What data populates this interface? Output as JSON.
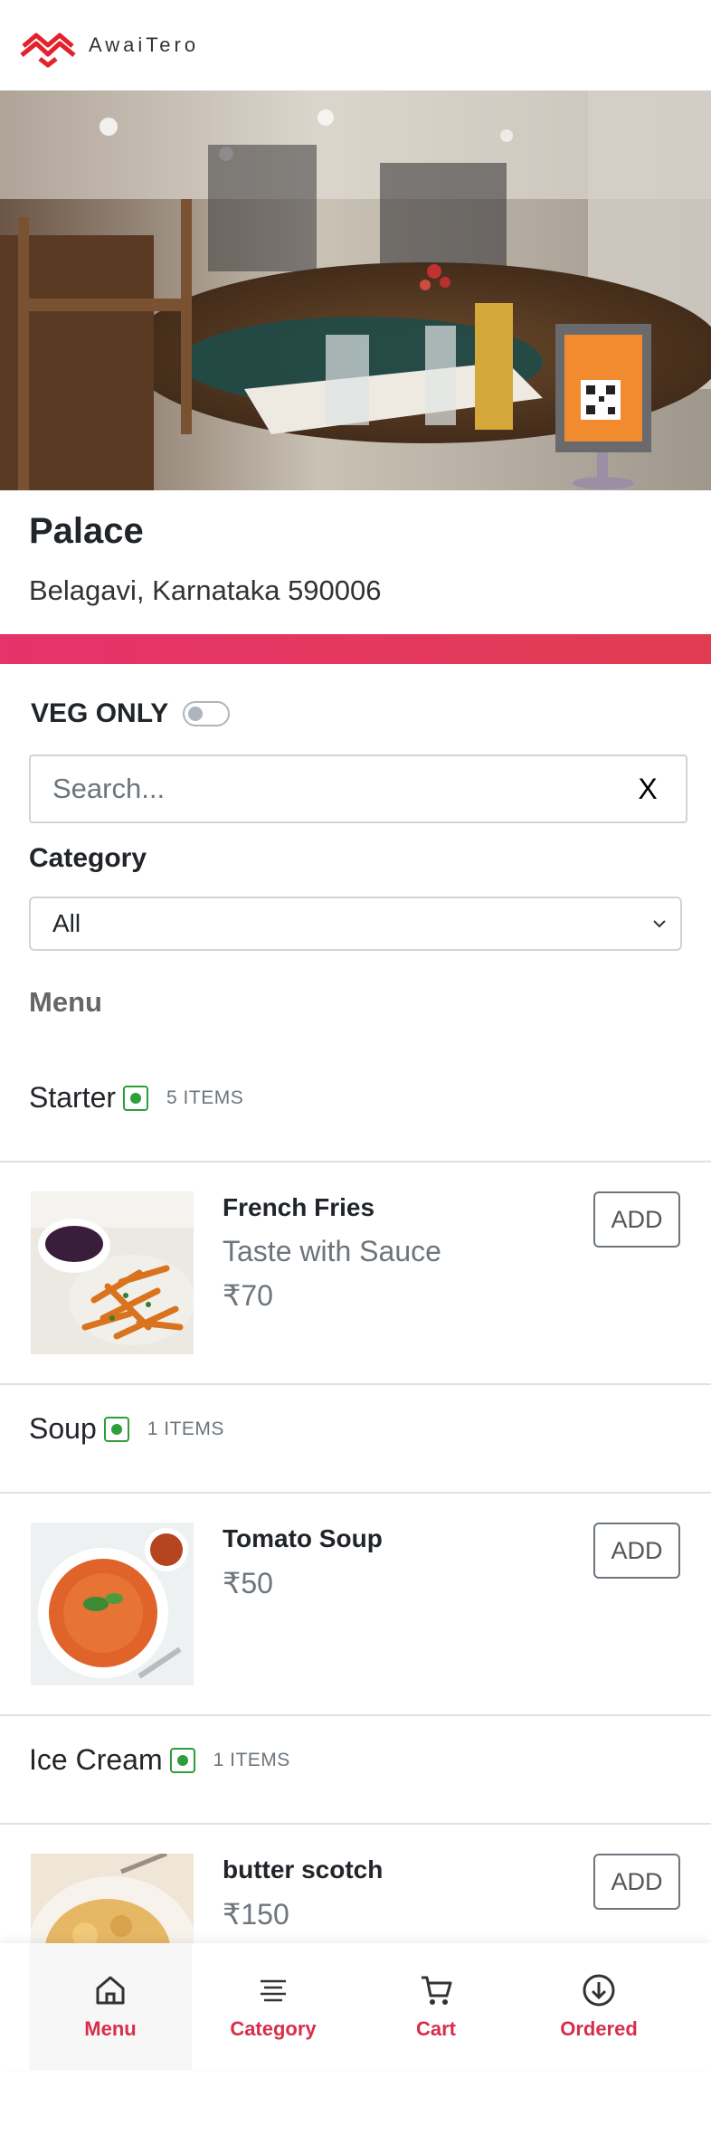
{
  "header": {
    "brand": "AwaiTero",
    "logo_icon": "awaitero-logo-icon"
  },
  "hero": {
    "image": "restaurant-table-photo",
    "qr_stand_icon": "qr-stand-icon"
  },
  "restaurant": {
    "name": "Palace",
    "address": "Belagavi, Karnataka 590006"
  },
  "colors": {
    "accent": "#d72f4b",
    "gradient_start": "#e5336b",
    "gradient_end": "#e23c52",
    "veg": "#2e9e3a"
  },
  "filters": {
    "veg_only_label": "VEG ONLY",
    "veg_only_enabled": false,
    "search_placeholder": "Search...",
    "search_value": "",
    "search_clear": "X",
    "category_label": "Category",
    "category_selected": "All"
  },
  "menu": {
    "title": "Menu",
    "sections": [
      {
        "name": "Starter",
        "count": "5 ITEMS",
        "veg": true,
        "items": [
          {
            "name": "French Fries",
            "description": "Taste with Sauce",
            "price": "₹70",
            "add_label": "ADD"
          }
        ]
      },
      {
        "name": "Soup",
        "count": "1 ITEMS",
        "veg": true,
        "items": [
          {
            "name": "Tomato Soup",
            "description": "",
            "price": "₹50",
            "add_label": "ADD"
          }
        ]
      },
      {
        "name": "Ice Cream",
        "count": "1 ITEMS",
        "veg": true,
        "items": [
          {
            "name": "butter scotch",
            "description": "",
            "price": "₹150",
            "add_label": "ADD"
          }
        ]
      }
    ]
  },
  "bottom_nav": [
    {
      "label": "Menu",
      "icon": "home-icon",
      "active": true
    },
    {
      "label": "Category",
      "icon": "list-icon",
      "active": false
    },
    {
      "label": "Cart",
      "icon": "cart-icon",
      "active": false
    },
    {
      "label": "Ordered",
      "icon": "download-circle-icon",
      "active": false
    }
  ]
}
